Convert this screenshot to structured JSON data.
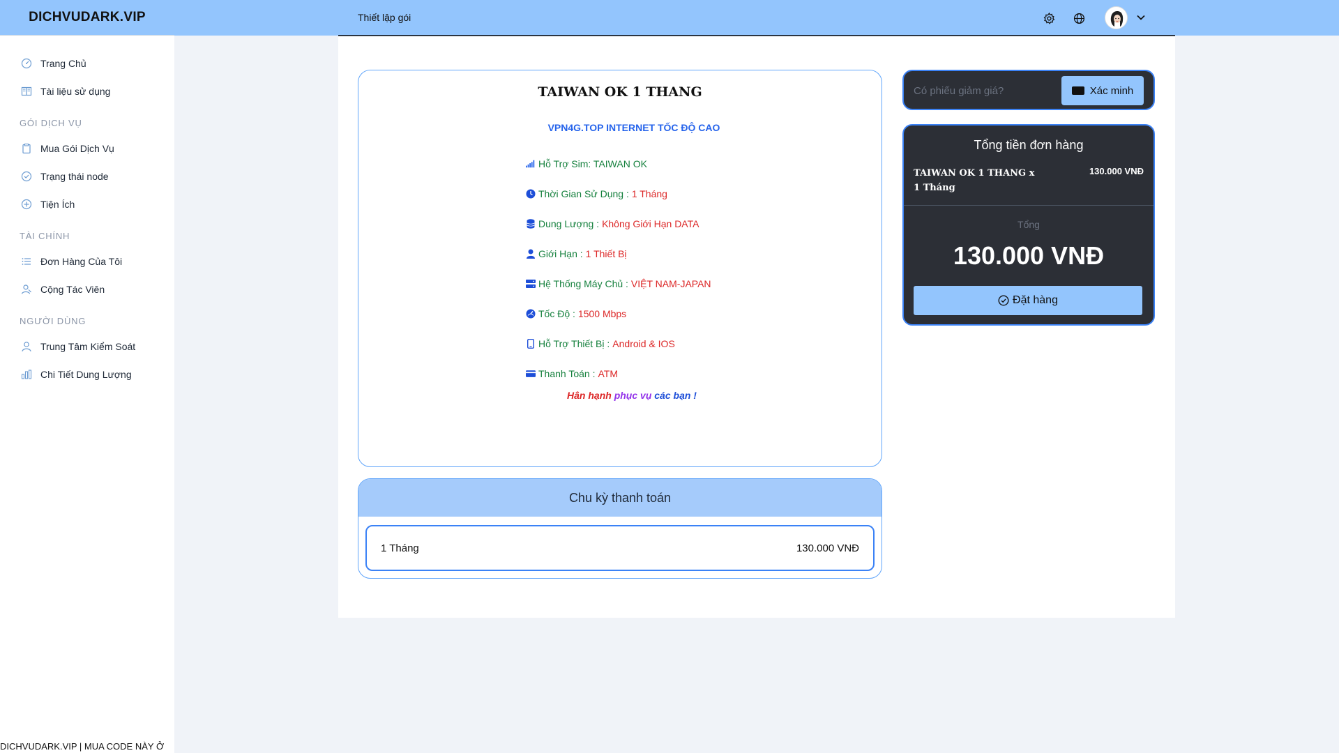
{
  "brand": {
    "name": "DICHVUDARK.VIP"
  },
  "sidebar": {
    "items_main": [
      {
        "label": "Trang Chủ",
        "icon": "dashboard-icon"
      },
      {
        "label": "Tài liệu sử dụng",
        "icon": "book-icon"
      }
    ],
    "sections": [
      {
        "title": "GÓI DỊCH VỤ",
        "items": [
          {
            "label": "Mua Gói Dịch Vụ",
            "icon": "clipboard-icon"
          },
          {
            "label": "Trạng thái node",
            "icon": "check-circle-icon"
          },
          {
            "label": "Tiện Ích",
            "icon": "plus-circle-icon"
          }
        ]
      },
      {
        "title": "TÀI CHÍNH",
        "items": [
          {
            "label": "Đơn Hàng Của Tôi",
            "icon": "list-icon"
          },
          {
            "label": "Cộng Tác Viên",
            "icon": "users-icon"
          }
        ]
      },
      {
        "title": "NGƯỜI DÙNG",
        "items": [
          {
            "label": "Trung Tâm Kiểm Soát",
            "icon": "user-icon"
          },
          {
            "label": "Chi Tiết Dung Lượng",
            "icon": "bar-chart-icon"
          }
        ]
      }
    ],
    "footer": "DICHVUDARK.VIP | MUA CODE NÀY Ở"
  },
  "topbar": {
    "page_label": "Thiết lập gói",
    "icons": [
      "gear-icon",
      "globe-icon",
      "avatar",
      "chevron-down-icon"
    ]
  },
  "plan": {
    "title": "TAIWAN OK 1 THANG",
    "subtitle": "VPN4G.TOP INTERNET TỐC ĐỘ CAO",
    "features": [
      {
        "icon": "signal-icon",
        "label": "Hỗ Trợ Sim: TAIWAN OK",
        "value": ""
      },
      {
        "icon": "clock-icon",
        "label": "Thời Gian Sử Dụng :",
        "value": "1 Tháng"
      },
      {
        "icon": "database-icon",
        "label": "Dung Lượng :",
        "value": "Không Giới Hạn DATA"
      },
      {
        "icon": "user-icon",
        "label": "Giới Hạn :",
        "value": "1 Thiết Bị"
      },
      {
        "icon": "server-icon",
        "label": "Hệ Thống Máy Chủ :",
        "value": "VIỆT NAM-JAPAN"
      },
      {
        "icon": "speed-icon",
        "label": "Tốc Độ :",
        "value": "1500 Mbps"
      },
      {
        "icon": "phone-icon",
        "label": "Hỗ Trợ Thiết Bị :",
        "value": "Android & IOS"
      },
      {
        "icon": "card-icon",
        "label": "Thanh Toán :",
        "value": "ATM"
      }
    ],
    "thanks": {
      "part1": "Hân hạnh ",
      "part2": "phục vụ ",
      "part3": "các bạn !"
    },
    "colors": {
      "label": "#15803d",
      "value": "#dc2626",
      "subtitle": "#2563eb"
    }
  },
  "cycle": {
    "title": "Chu kỳ thanh toán",
    "option": {
      "label": "1 Tháng",
      "price": "130.000 VNĐ"
    }
  },
  "coupon": {
    "placeholder": "Có phiếu giảm giá?",
    "button": "Xác minh"
  },
  "summary": {
    "title": "Tổng tiền đơn hàng",
    "line_name": "TAIWAN OK 1 THANG x 1 Tháng",
    "line_price": "130.000 VNĐ",
    "total_label": "Tổng",
    "total_value": "130.000 VNĐ",
    "order_button": "Đặt hàng"
  },
  "theme": {
    "accent": "#93c5fd",
    "border": "#3b82f6",
    "dark": "#2c2f36"
  }
}
